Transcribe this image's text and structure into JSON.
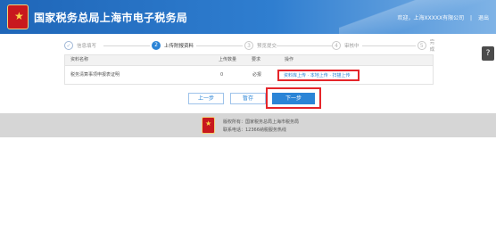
{
  "header": {
    "title": "国家税务总局上海市电子税务局",
    "welcome": "欢迎，上海XXXXX有限公司",
    "separator": "|",
    "logout": "退出",
    "colors": {
      "bar": "#2f7ed0",
      "emblem": "#c8191e"
    }
  },
  "steps": [
    {
      "label": "信息填写",
      "state": "done",
      "icon": "check-icon"
    },
    {
      "label": "上传附报资料",
      "state": "active",
      "number": "2"
    },
    {
      "label": "预览提交",
      "state": "todo",
      "number": "3"
    },
    {
      "label": "审核中",
      "state": "todo",
      "number": "4"
    },
    {
      "label": "完成",
      "state": "todo",
      "number": "5"
    }
  ],
  "table": {
    "headers": [
      "资料名称",
      "上传数量",
      "要求",
      "操作"
    ],
    "rows": [
      {
        "name": "税务清算事项申报表证明",
        "count": "0",
        "requirement": "必报",
        "operation": "资料库上传 · 本地上传 · 扫描上传"
      }
    ]
  },
  "buttons": {
    "prev": "上一步",
    "save": "暂存",
    "next": "下一步"
  },
  "help": {
    "icon": "help-icon",
    "label": "?"
  },
  "footer": {
    "line1": "版权所有：国家税务总局上海市税务局",
    "line2": "联系电话：12366纳税服务热线"
  },
  "highlight_color": "#e5252a",
  "accent_color": "#2b84d6"
}
